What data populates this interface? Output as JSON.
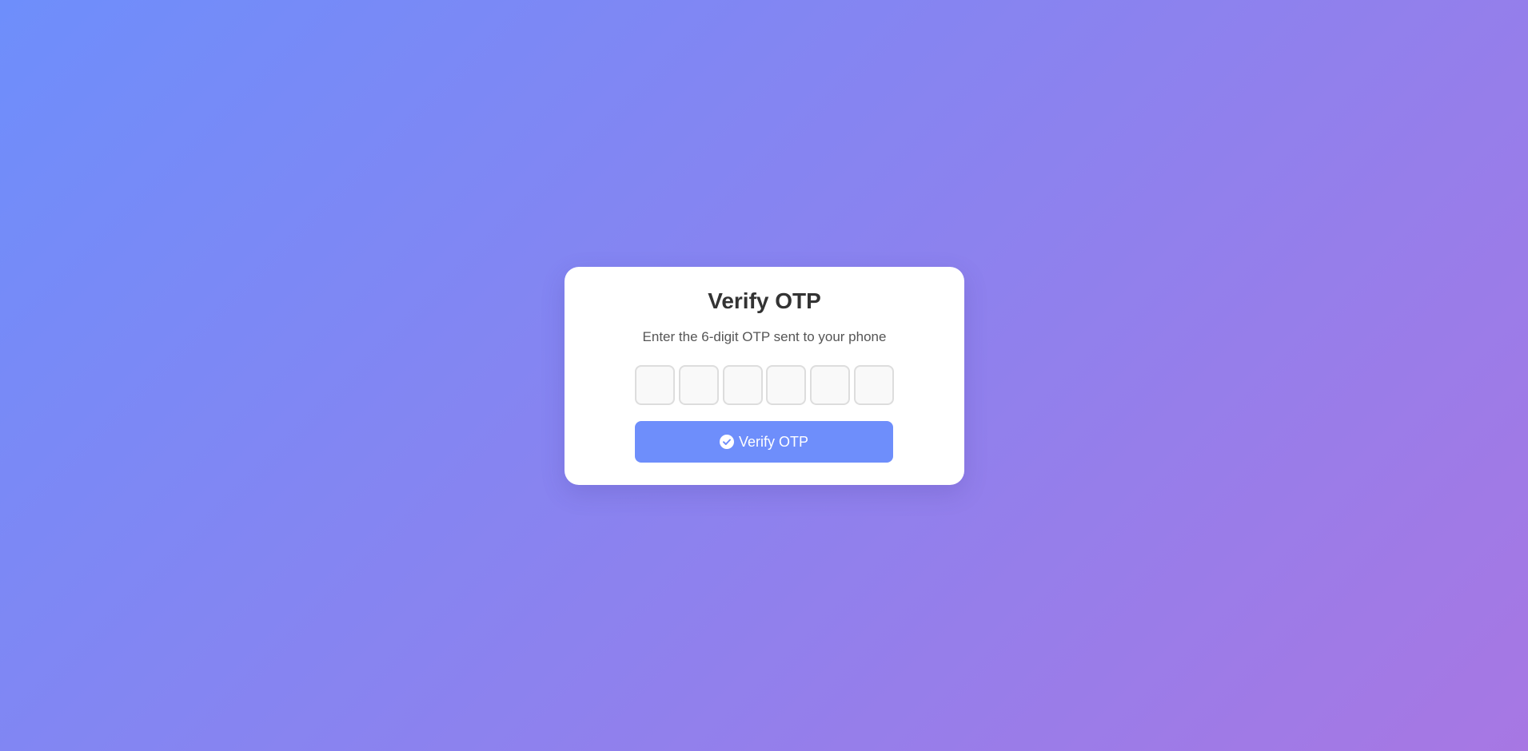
{
  "card": {
    "title": "Verify OTP",
    "subtitle": "Enter the 6-digit OTP sent to your phone"
  },
  "otp": {
    "digits": [
      "",
      "",
      "",
      "",
      "",
      ""
    ]
  },
  "verify_button": {
    "label": "Verify OTP",
    "icon": "check-circle-icon"
  },
  "colors": {
    "gradient_start": "#6e8efb",
    "gradient_end": "#a777e3",
    "button": "#6e8efb"
  }
}
